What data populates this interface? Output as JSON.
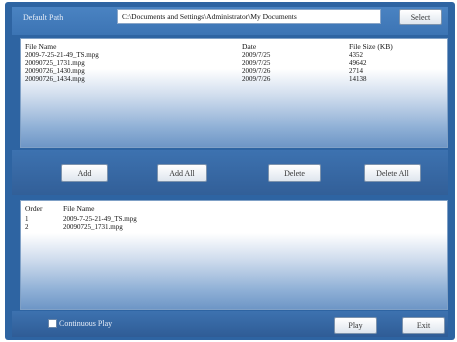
{
  "path": {
    "label": "Default Path",
    "value": "C:\\Documents and Settings\\Administrator\\My Documents",
    "select_label": "Select"
  },
  "files": {
    "columns": [
      "File Name",
      "Date",
      "File Size (KB)"
    ],
    "rows": [
      [
        "2009-7-25-21-49_TS.mpg",
        "2009/7/25",
        "4352"
      ],
      [
        "20090725_1731.mpg",
        "2009/7/25",
        "49642"
      ],
      [
        "20090726_1430.mpg",
        "2009/7/26",
        "2714"
      ],
      [
        "20090726_1434.mpg",
        "2009/7/26",
        "14138"
      ]
    ]
  },
  "actions": {
    "add": "Add",
    "add_all": "Add All",
    "delete": "Delete",
    "delete_all": "Delete All"
  },
  "playlist": {
    "columns": [
      "Order",
      "File Name"
    ],
    "rows": [
      [
        "1",
        "2009-7-25-21-49_TS.mpg"
      ],
      [
        "2",
        "20090725_1731.mpg"
      ]
    ]
  },
  "footer": {
    "continuous_play": "Continuous Play",
    "play": "Play",
    "exit": "Exit"
  }
}
